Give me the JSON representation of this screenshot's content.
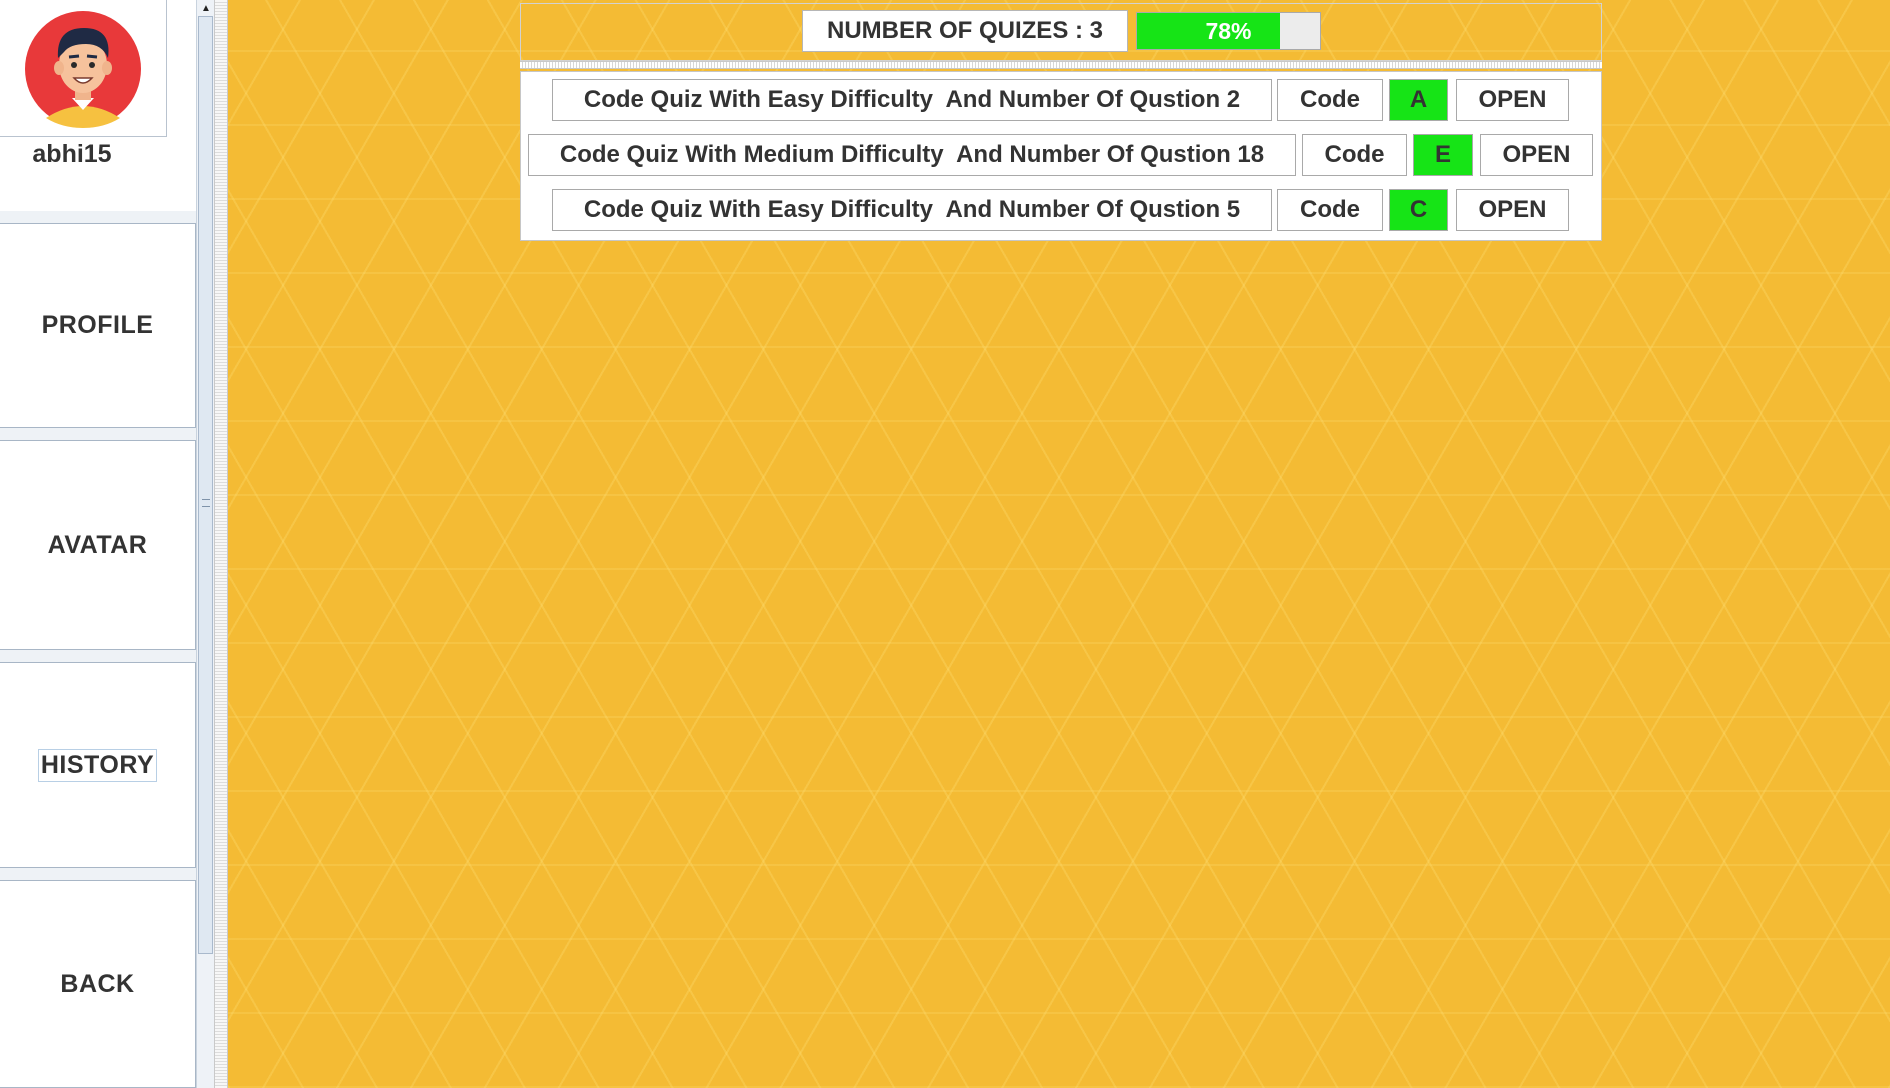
{
  "sidebar": {
    "username": "abhi15",
    "nav": [
      {
        "label": "PROFILE"
      },
      {
        "label": "AVATAR"
      },
      {
        "label": "HISTORY"
      },
      {
        "label": "BACK"
      }
    ]
  },
  "header": {
    "quiz_count_label": "NUMBER OF QUIZES : 3",
    "progress_value": 0.78,
    "progress_label": "78%"
  },
  "quizzes": [
    {
      "title": "Code Quiz With Easy Difficulty  And Number Of Qustion 2",
      "code_label": "Code",
      "code": "A",
      "open_label": "OPEN"
    },
    {
      "title": "Code Quiz With Medium Difficulty  And Number Of Qustion 18",
      "code_label": "Code",
      "code": "E",
      "open_label": "OPEN"
    },
    {
      "title": "Code Quiz With Easy Difficulty  And Number Of Qustion 5",
      "code_label": "Code",
      "code": "C",
      "open_label": "OPEN"
    }
  ],
  "colors": {
    "background": "#f4bb34",
    "progress_fill": "#16e416",
    "badge": "#16e416"
  }
}
